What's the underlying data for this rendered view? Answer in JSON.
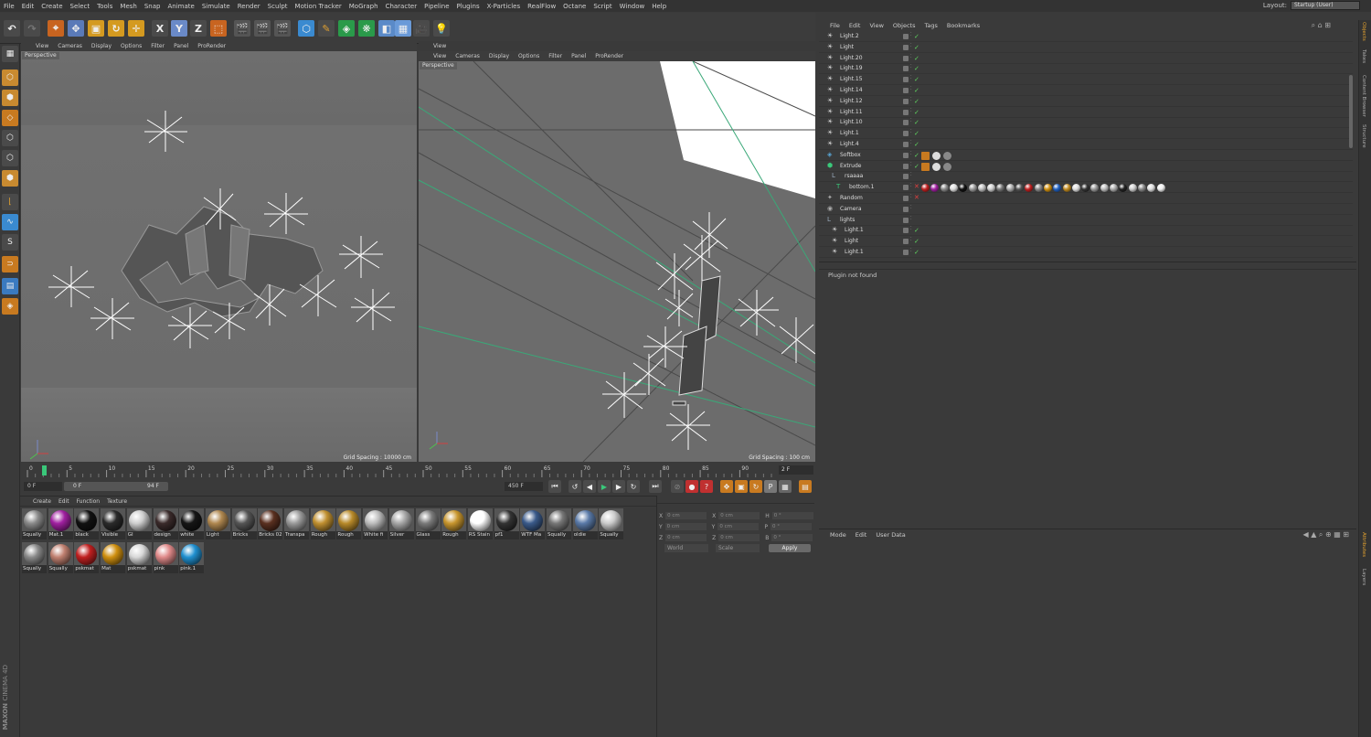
{
  "menu": [
    "File",
    "Edit",
    "Create",
    "Select",
    "Tools",
    "Mesh",
    "Snap",
    "Animate",
    "Simulate",
    "Render",
    "Sculpt",
    "Motion Tracker",
    "MoGraph",
    "Character",
    "Pipeline",
    "Plugins",
    "X-Particles",
    "RealFlow",
    "Octane",
    "Script",
    "Window",
    "Help"
  ],
  "layout": {
    "label": "Layout:",
    "value": "Startup (User)"
  },
  "toolbar_icons": [
    "undo-icon",
    "redo-icon",
    "live-select-icon",
    "move-icon",
    "scale-icon",
    "rotate-icon",
    "recent-tool-icon",
    "x-axis-icon",
    "y-axis-icon",
    "z-axis-icon",
    "world-coord-icon",
    "render-view-icon",
    "render-picture-viewer-icon",
    "edit-render-settings-icon",
    "cube-icon",
    "pen-icon",
    "subdivision-icon",
    "cloner-icon",
    "plane-deformer-icon",
    "environment-icon",
    "camera-icon",
    "light-icon"
  ],
  "toolbar_axis": {
    "x": "X",
    "y": "Y",
    "z": "Z"
  },
  "viewport_left": {
    "menu": [
      "View",
      "Cameras",
      "Display",
      "Options",
      "Filter",
      "Panel",
      "ProRender"
    ],
    "label": "Perspective",
    "grid_spacing": "Grid Spacing : 10000 cm"
  },
  "viewport_right": {
    "title": "View",
    "menu": [
      "View",
      "Cameras",
      "Display",
      "Options",
      "Filter",
      "Panel",
      "ProRender"
    ],
    "label": "Perspective",
    "grid_spacing": "Grid Spacing : 100 cm"
  },
  "timeline": {
    "ticks": [
      "0",
      "5",
      "10",
      "15",
      "20",
      "25",
      "30",
      "35",
      "40",
      "45",
      "50",
      "55",
      "60",
      "65",
      "70",
      "75",
      "80",
      "85",
      "90"
    ],
    "current_frame": "2 F"
  },
  "playback": {
    "start": "0 F",
    "range_start": "0 F",
    "range_end": "94 F",
    "end": "450 F"
  },
  "material_manager": {
    "menu": [
      "Create",
      "Edit",
      "Function",
      "Texture"
    ],
    "materials": [
      {
        "name": "Squally",
        "color": "#8a8a8a"
      },
      {
        "name": "Mat.1",
        "color": "#a020a0"
      },
      {
        "name": "black",
        "color": "#111111"
      },
      {
        "name": "Visible",
        "color": "#2a2a2a"
      },
      {
        "name": "GI",
        "color": "#cfcfcf"
      },
      {
        "name": "design",
        "color": "#3a2a2a"
      },
      {
        "name": "white",
        "color": "#151515"
      },
      {
        "name": "Light",
        "color": "#b08850"
      },
      {
        "name": "Bricks",
        "color": "#555555"
      },
      {
        "name": "Bricks 02",
        "color": "#5a3020"
      },
      {
        "name": "Transpa",
        "color": "#9a9a9a"
      },
      {
        "name": "Rough",
        "color": "#c09030"
      },
      {
        "name": "Rough",
        "color": "#b88a2a"
      },
      {
        "name": "White fi",
        "color": "#bdbdbd"
      },
      {
        "name": "Silver",
        "color": "#a6a6a6"
      },
      {
        "name": "Glass",
        "color": "#7a7a7a"
      },
      {
        "name": "Rough",
        "color": "#c8962e"
      },
      {
        "name": "RS Stain",
        "color": "#ffffff"
      },
      {
        "name": "pf1",
        "color": "#333333"
      },
      {
        "name": "WTF Ma",
        "color": "#3a5a8a"
      },
      {
        "name": "Squally",
        "color": "#777777"
      },
      {
        "name": "oldie",
        "color": "#5a7aa8"
      },
      {
        "name": "Squally",
        "color": "#cccccc"
      },
      {
        "name": "Squally",
        "color": "#8a8a8a"
      },
      {
        "name": "Squally",
        "color": "#c08070"
      },
      {
        "name": "pskmat",
        "color": "#c02020"
      },
      {
        "name": "Mat",
        "color": "#d09010"
      },
      {
        "name": "pskmat",
        "color": "#d8d8d8"
      },
      {
        "name": "pink",
        "color": "#e08a8a"
      },
      {
        "name": "pink.1",
        "color": "#2090d0"
      }
    ]
  },
  "coordinates": {
    "rows": [
      [
        "X",
        "0 cm",
        "X",
        "0 cm",
        "H",
        "0 °"
      ],
      [
        "Y",
        "0 cm",
        "Y",
        "0 cm",
        "P",
        "0 °"
      ],
      [
        "Z",
        "0 cm",
        "Z",
        "0 cm",
        "B",
        "0 °"
      ]
    ],
    "mode1": "World",
    "mode2": "Scale",
    "apply": "Apply"
  },
  "object_manager": {
    "menu": [
      "File",
      "Edit",
      "View",
      "Objects",
      "Tags",
      "Bookmarks"
    ],
    "objects": [
      {
        "name": "Light.2",
        "indent": 1,
        "icon": "light-icon",
        "status": "ok"
      },
      {
        "name": "Light",
        "indent": 1,
        "icon": "light-icon",
        "status": "ok"
      },
      {
        "name": "Light.20",
        "indent": 1,
        "icon": "light-icon",
        "status": "ok"
      },
      {
        "name": "Light.19",
        "indent": 1,
        "icon": "light-icon",
        "status": "ok"
      },
      {
        "name": "Light.15",
        "indent": 1,
        "icon": "light-icon",
        "status": "ok"
      },
      {
        "name": "Light.14",
        "indent": 1,
        "icon": "light-icon",
        "status": "ok"
      },
      {
        "name": "Light.12",
        "indent": 1,
        "icon": "light-icon",
        "status": "ok"
      },
      {
        "name": "Light.11",
        "indent": 1,
        "icon": "light-icon",
        "status": "ok"
      },
      {
        "name": "Light.10",
        "indent": 1,
        "icon": "light-icon",
        "status": "ok"
      },
      {
        "name": "Light.1",
        "indent": 1,
        "icon": "light-icon",
        "status": "ok"
      },
      {
        "name": "Light.4",
        "indent": 1,
        "icon": "light-icon",
        "status": "ok"
      },
      {
        "name": "Softbox",
        "indent": 1,
        "icon": "softbox-icon",
        "status": "ok"
      },
      {
        "name": "Extrude",
        "indent": 1,
        "icon": "extrude-icon",
        "status": "ok"
      },
      {
        "name": "rsaaaa",
        "indent": 2,
        "icon": "null-icon",
        "status": "none"
      },
      {
        "name": "bottom.1",
        "indent": 3,
        "icon": "text-icon",
        "status": "x"
      },
      {
        "name": "Random",
        "indent": 1,
        "icon": "random-icon",
        "status": "x"
      },
      {
        "name": "Camera",
        "indent": 1,
        "icon": "camera-icon",
        "status": "none"
      },
      {
        "name": "lights",
        "indent": 1,
        "icon": "null-icon",
        "status": "none"
      },
      {
        "name": "Light.1",
        "indent": 2,
        "icon": "light-icon",
        "status": "ok"
      },
      {
        "name": "Light",
        "indent": 2,
        "icon": "light-icon",
        "status": "ok"
      },
      {
        "name": "Light.1",
        "indent": 2,
        "icon": "light-icon",
        "status": "ok"
      }
    ],
    "bottom_tag_colors": [
      "#c02020",
      "#a020a0",
      "#888",
      "#ddd",
      "#111",
      "#999",
      "#bbb",
      "#ccc",
      "#777",
      "#aaa",
      "#555",
      "#c02020",
      "#888",
      "#d09010",
      "#2060c0",
      "#c08a20",
      "#ddd",
      "#333",
      "#999",
      "#bbb",
      "#aaa",
      "#222",
      "#ccc",
      "#888",
      "#ddd",
      "#eee"
    ]
  },
  "plugin_panel": {
    "message": "Plugin not found"
  },
  "attributes": {
    "menu": [
      "Mode",
      "Edit",
      "User Data"
    ]
  },
  "right_tabs": [
    "Objects",
    "Takes",
    "Content Browser",
    "Structure",
    "Attributes",
    "Layers"
  ],
  "brand": {
    "line1": "MAXON",
    "line2": "CINEMA 4D"
  }
}
